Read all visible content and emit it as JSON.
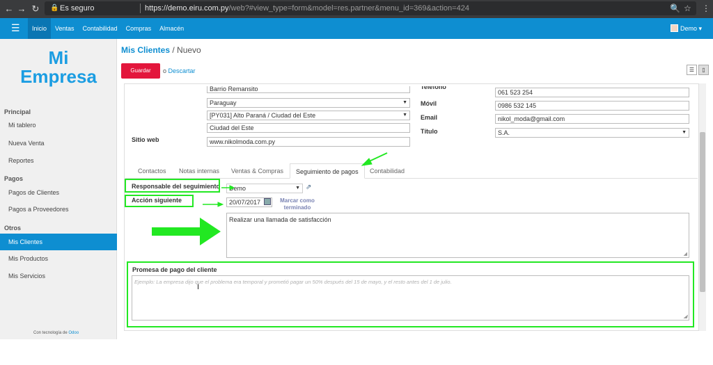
{
  "browser": {
    "secure_label": "Es seguro",
    "url_host": "https://demo.eiru.com.py",
    "url_path": "/web?#view_type=form&model=res.partner&menu_id=369&action=424"
  },
  "navbar": {
    "menu": [
      "Inicio",
      "Ventas",
      "Contabilidad",
      "Compras",
      "Almacén"
    ],
    "user": "Demo ▾"
  },
  "sidebar": {
    "logo_line1": "Mi",
    "logo_line2": "Empresa",
    "sections": [
      {
        "title": "Principal",
        "items": [
          "Mi tablero",
          "Nueva Venta",
          "Reportes"
        ]
      },
      {
        "title": "Pagos",
        "items": [
          "Pagos de Clientes",
          "Pagos a Proveedores"
        ]
      },
      {
        "title": "Otros",
        "items": [
          "Mis Clientes",
          "Mis Productos",
          "Mis Servicios"
        ]
      }
    ],
    "powered_prefix": "Con tecnología de ",
    "powered_brand": "Odoo"
  },
  "header": {
    "crumb": "Mis Clientes",
    "separator": " / ",
    "current": "Nuevo",
    "save_label": "Guardar",
    "discard_or": "o ",
    "discard_label": "Descartar"
  },
  "form": {
    "street2": "Barrio Remansito",
    "country": "Paraguay",
    "state": "[PY031] Alto Paraná / Ciudad del Este",
    "city": "Ciudad del Este",
    "website_label": "Sitio web",
    "website": "www.nikolmoda.com.py",
    "phone_label": "Teléfono",
    "phone": "061 523 254",
    "mobile_label": "Móvil",
    "mobile": "0986 532 145",
    "email_label": "Email",
    "email": "nikol_moda@gmail.com",
    "title_label": "Título",
    "title_value": "S.A."
  },
  "tabs": [
    "Contactos",
    "Notas internas",
    "Ventas & Compras",
    "Seguimiento de pagos",
    "Contabilidad"
  ],
  "followup": {
    "responsible_label": "Responsable del seguimiento",
    "responsible_value": "Demo",
    "next_action_label": "Acción siguiente",
    "next_action_date": "20/07/2017",
    "mark_done_line1": "Marcar como",
    "mark_done_line2": "terminado",
    "action_text": "Realizar una llamada de satisfacción",
    "promise_label": "Promesa de pago del cliente",
    "promise_placeholder": "Ejemplo: La empresa dijo que el problema era temporal y prometió pagar un 50% después del 15 de mayo, y el resto antes del 1 de julio."
  },
  "colors": {
    "brand": "#0e8ed1",
    "save": "#e3163c",
    "annotation": "#22e822"
  }
}
